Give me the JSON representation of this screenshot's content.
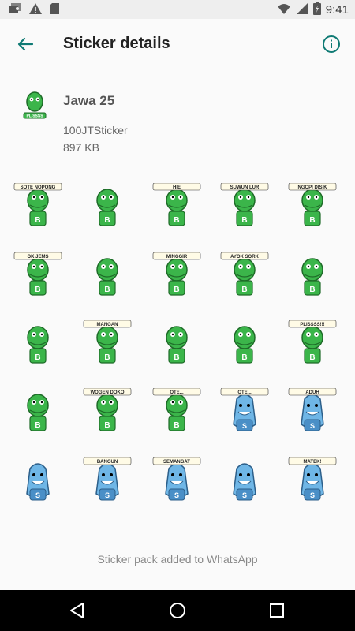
{
  "status_bar": {
    "time": "9:41",
    "left_icons": [
      "photos-notification-icon",
      "warning-icon",
      "sd-card-icon"
    ],
    "right_icons": [
      "wifi-icon",
      "signal-icon",
      "battery-icon"
    ]
  },
  "app_bar": {
    "title": "Sticker details",
    "back_icon": "arrow-back-icon",
    "info_icon": "info-icon",
    "accent": "#0f7a74"
  },
  "pack": {
    "name": "Jawa 25",
    "publisher": "100JTSticker",
    "size": "897 KB",
    "tray_caption": "PLISSSS"
  },
  "stickers": [
    {
      "kind": "croc",
      "caption": "SOTE NOPONG",
      "accent": "#3bb54a"
    },
    {
      "kind": "croc",
      "caption": "",
      "accent": "#3bb54a"
    },
    {
      "kind": "croc",
      "caption": "HIE",
      "accent": "#3bb54a"
    },
    {
      "kind": "croc",
      "caption": "SUWUN LUR",
      "accent": "#3bb54a"
    },
    {
      "kind": "croc",
      "caption": "NGOPI DISIK",
      "accent": "#3bb54a"
    },
    {
      "kind": "croc",
      "caption": "OK JEMS",
      "accent": "#3bb54a"
    },
    {
      "kind": "croc",
      "caption": "",
      "accent": "#3bb54a"
    },
    {
      "kind": "croc",
      "caption": "MINGGIR",
      "accent": "#3bb54a"
    },
    {
      "kind": "croc",
      "caption": "AYOK SORK",
      "accent": "#3bb54a"
    },
    {
      "kind": "croc",
      "caption": "",
      "accent": "#3bb54a"
    },
    {
      "kind": "croc",
      "caption": "",
      "accent": "#3bb54a"
    },
    {
      "kind": "croc",
      "caption": "MANGAN",
      "accent": "#3bb54a"
    },
    {
      "kind": "croc",
      "caption": "",
      "accent": "#3bb54a"
    },
    {
      "kind": "croc",
      "caption": "",
      "accent": "#3bb54a"
    },
    {
      "kind": "croc",
      "caption": "PLISSSS!!!",
      "accent": "#3bb54a"
    },
    {
      "kind": "croc",
      "caption": "",
      "accent": "#3bb54a"
    },
    {
      "kind": "croc",
      "caption": "WOGEN DOKO",
      "accent": "#3bb54a"
    },
    {
      "kind": "croc",
      "caption": "OTE...",
      "accent": "#3bb54a"
    },
    {
      "kind": "shark",
      "caption": "OTE...",
      "accent": "#6fb6e6"
    },
    {
      "kind": "shark",
      "caption": "ADUH",
      "accent": "#6fb6e6"
    },
    {
      "kind": "shark",
      "caption": "",
      "accent": "#6fb6e6"
    },
    {
      "kind": "shark",
      "caption": "BANGUN",
      "accent": "#6fb6e6"
    },
    {
      "kind": "shark",
      "caption": "SEMANGAT",
      "accent": "#6fb6e6"
    },
    {
      "kind": "shark",
      "caption": "",
      "accent": "#6fb6e6"
    },
    {
      "kind": "shark",
      "caption": "MATEK!",
      "accent": "#6fb6e6"
    }
  ],
  "footer": {
    "message": "Sticker pack added to WhatsApp"
  },
  "nav_bar": {
    "icons": [
      "nav-back-icon",
      "nav-home-icon",
      "nav-recents-icon"
    ]
  }
}
